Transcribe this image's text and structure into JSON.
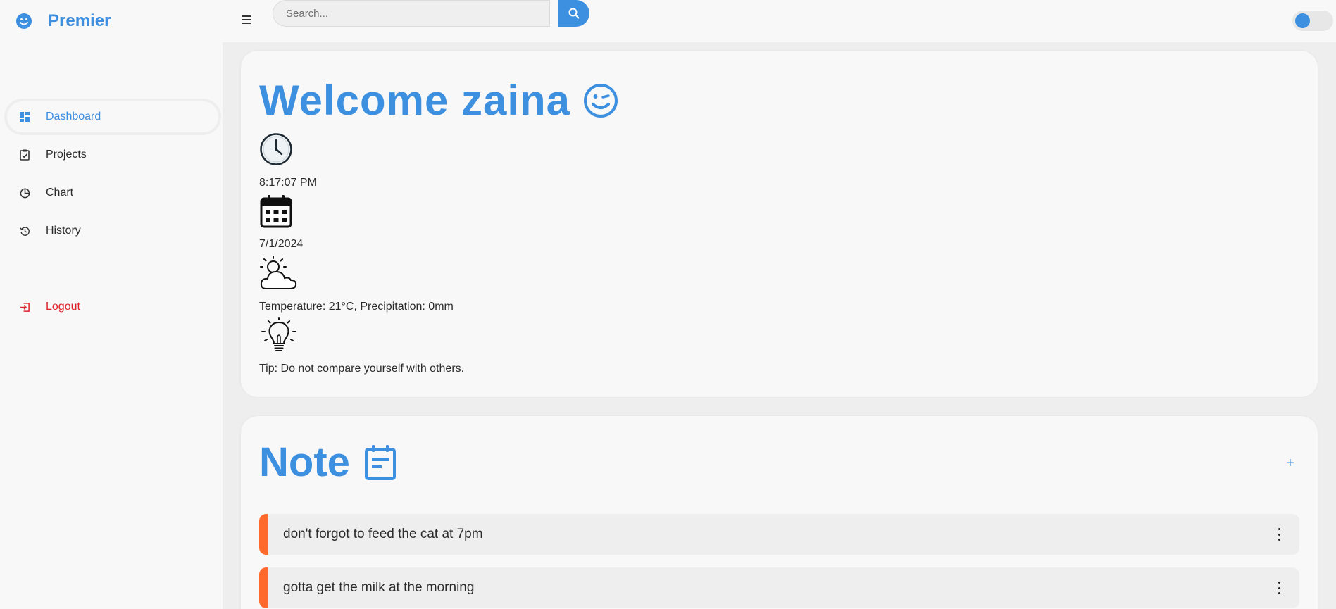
{
  "app": {
    "brand_name": "Premier",
    "brand_icon": "smiley-icon"
  },
  "header": {
    "menu_icon": "hamburger-icon",
    "search": {
      "placeholder": "Search...",
      "value": "",
      "button_icon": "search-icon"
    },
    "theme_toggle": {
      "state": "off"
    }
  },
  "sidebar": {
    "items": [
      {
        "label": "Dashboard",
        "icon": "dashboard-icon",
        "active": true
      },
      {
        "label": "Projects",
        "icon": "clipboard-check-icon",
        "active": false
      },
      {
        "label": "Chart",
        "icon": "pie-chart-icon",
        "active": false
      },
      {
        "label": "History",
        "icon": "history-icon",
        "active": false
      }
    ],
    "logout": {
      "label": "Logout",
      "icon": "logout-icon"
    }
  },
  "welcome": {
    "title": "Welcome zaina",
    "time": "8:17:07 PM",
    "date": "7/1/2024",
    "weather": "Temperature: 21°C, Precipitation: 0mm",
    "tip": "Tip: Do not compare yourself with others."
  },
  "notes": {
    "title": "Note",
    "add_label": "+",
    "items": [
      {
        "text": "don't forgot to feed the cat at 7pm"
      },
      {
        "text": "gotta get the milk at the morning"
      }
    ]
  },
  "colors": {
    "accent": "#3d8fe0",
    "logout": "#e0202a",
    "note_stripe": "#ff6a2c",
    "background": "#eeeeee",
    "panel": "#f8f8f8"
  }
}
